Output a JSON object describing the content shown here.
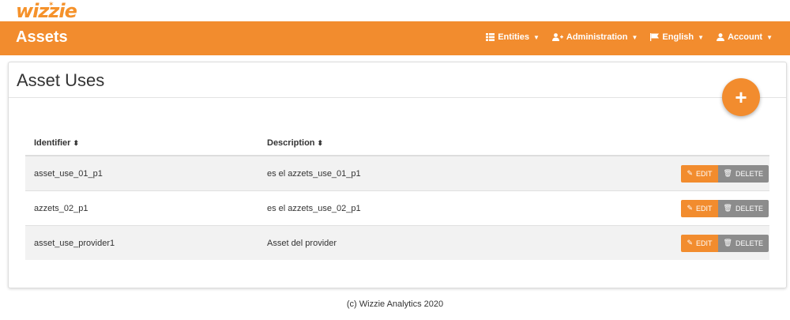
{
  "brand": {
    "logo_text": "wizzie"
  },
  "header": {
    "title": "Assets",
    "menu": [
      {
        "label": "Entities",
        "icon": "list-icon"
      },
      {
        "label": "Administration",
        "icon": "user-plus-icon"
      },
      {
        "label": "English",
        "icon": "flag-icon"
      },
      {
        "label": "Account",
        "icon": "user-icon"
      }
    ]
  },
  "panel": {
    "title": "Asset Uses",
    "add_button": "+"
  },
  "table": {
    "columns": [
      "Identifier",
      "Description"
    ],
    "rows": [
      {
        "identifier": "asset_use_01_p1",
        "description": "es el azzets_use_01_p1"
      },
      {
        "identifier": "azzets_02_p1",
        "description": "es el azzets_use_02_p1"
      },
      {
        "identifier": "asset_use_provider1",
        "description": "Asset del provider"
      }
    ],
    "edit_label": "EDIT",
    "delete_label": "DELETE"
  },
  "footer": {
    "text": "(c) Wizzie Analytics 2020"
  },
  "colors": {
    "accent": "#f28c2e",
    "delete": "#8c8c8c"
  }
}
